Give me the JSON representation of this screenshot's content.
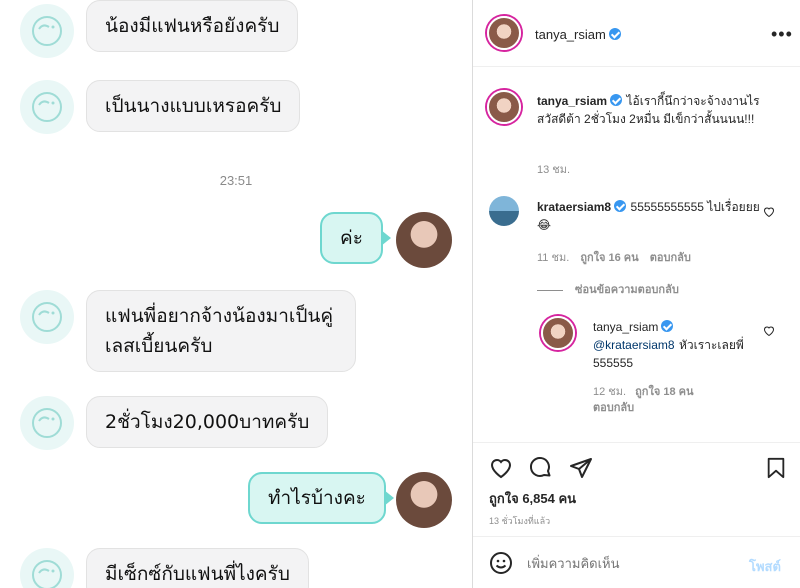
{
  "chat": {
    "messages": [
      {
        "text": "น้องมีแฟนหรือยังครับ"
      },
      {
        "text": "เป็นนางแบบเหรอครับ"
      },
      {
        "time": "23:51"
      },
      {
        "text": "ค่ะ"
      },
      {
        "text": "แฟนพี่อยากจ้างน้องมาเป็นคู่เลสเบี้ยนครับ"
      },
      {
        "text": "2ชั่วโมง20,000บาทครับ"
      },
      {
        "text": "ทำไรบ้างคะ"
      },
      {
        "text": "มีเซ็กซ์กับแฟนพี่ไงครับ"
      }
    ]
  },
  "post": {
    "header": {
      "username": "tanya_rsiam",
      "more_icon": "more-icon"
    },
    "caption": {
      "username": "tanya_rsiam",
      "text": "ไอ้เรากี็นึกว่าจะจ้างงานไร สวัสดีต้า 2ชั่วโมง 2หมื่น มีเข็กว่าสั้นนนน!!!",
      "time": "13 ชม."
    },
    "comments": [
      {
        "username": "krataersiam8",
        "text": "55555555555 ไปเรื่อยยย😂",
        "time": "11 ชม.",
        "likes": "ถูกใจ 16 คน",
        "reply_label": "ตอบกลับ",
        "thread_toggle": "ซ่อนข้อความตอบกลับ"
      },
      {
        "username": "tanya_rsiam",
        "mention": "@krataersiam8",
        "text": "หัวเราะเลยพี่ 555555",
        "time": "12 ชม.",
        "likes": "ถูกใจ 18 คน",
        "reply_label": "ตอบกลับ"
      }
    ],
    "actions": {
      "like_count": "ถูกใจ 6,854 คน",
      "timestamp": "13 ชั่วโมงที่แล้ว"
    },
    "composer": {
      "placeholder": "เพิ่มความคิดเห็น",
      "post_label": "โพสต์"
    }
  }
}
